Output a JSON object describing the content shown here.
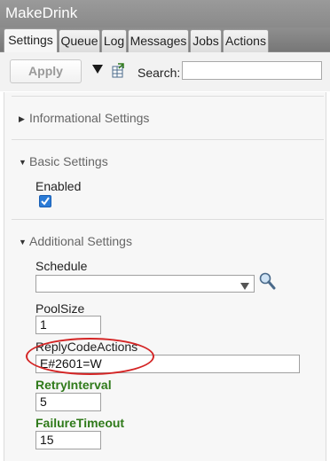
{
  "window": {
    "title": "MakeDrink"
  },
  "tabs": [
    {
      "label": "Settings",
      "active": true
    },
    {
      "label": "Queue"
    },
    {
      "label": "Log"
    },
    {
      "label": "Messages"
    },
    {
      "label": "Jobs"
    },
    {
      "label": "Actions"
    }
  ],
  "toolbar": {
    "apply_label": "Apply",
    "search_label": "Search:",
    "search_value": ""
  },
  "sections": {
    "informational": {
      "title": "Informational Settings",
      "expanded": false
    },
    "basic": {
      "title": "Basic Settings",
      "expanded": true
    },
    "additional": {
      "title": "Additional Settings",
      "expanded": true
    }
  },
  "fields": {
    "enabled": {
      "label": "Enabled",
      "checked": true
    },
    "schedule": {
      "label": "Schedule",
      "value": ""
    },
    "pool_size": {
      "label": "PoolSize",
      "value": "1"
    },
    "reply_code_actions": {
      "label": "ReplyCodeActions",
      "value": "E#2601=W"
    },
    "retry_interval": {
      "label": "RetryInterval",
      "value": "5"
    },
    "failure_timeout": {
      "label": "FailureTimeout",
      "value": "15"
    }
  },
  "colors": {
    "modified_label": "#2f7a1a",
    "highlight": "#d42525",
    "checkbox": "#2b7bd6"
  }
}
